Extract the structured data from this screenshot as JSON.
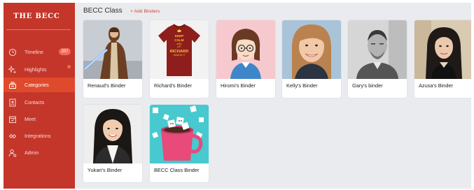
{
  "app": {
    "logo_text": "THE BECC"
  },
  "sidebar": {
    "items": [
      {
        "label": "Timeline",
        "icon": "clock-icon",
        "badge": "207"
      },
      {
        "label": "Highlights",
        "icon": "sparkle-icon"
      },
      {
        "label": "Categories",
        "icon": "stack-icon",
        "active": true
      },
      {
        "label": "Contacts",
        "icon": "contact-book-icon"
      },
      {
        "label": "Meet",
        "icon": "calendar-icon"
      },
      {
        "label": "Integrations",
        "icon": "link-icon"
      },
      {
        "label": "Admin",
        "icon": "admin-user-icon"
      }
    ]
  },
  "main": {
    "class_title": "BECC Class",
    "add_binders_label": "+ Add Binders",
    "binders": [
      {
        "label": "Renaud's Binder",
        "image": "jedi-costume-photo"
      },
      {
        "label": "Richard's Binder",
        "image": "red-tshirt-photo"
      },
      {
        "label": "Hiromi's Binder",
        "image": "cartoon-avatar"
      },
      {
        "label": "Kelly's Binder",
        "image": "portrait-photo"
      },
      {
        "label": "Gary's binder",
        "image": "portrait-photo-bw"
      },
      {
        "label": "Azusa's Binder",
        "image": "portrait-photo"
      },
      {
        "label": "Yukari's Binder",
        "image": "portrait-photo"
      },
      {
        "label": "BECC Class Binder",
        "image": "mug-illustration"
      }
    ],
    "tshirt_text": [
      "KEEP",
      "CALM",
      "AND",
      "LET",
      "RICHARD",
      "HANDLE IT"
    ]
  },
  "colors": {
    "sidebar_bg": "#c4362a",
    "sidebar_active": "#e04a2c",
    "accent": "#d0453a",
    "content_bg": "#e9ebee"
  }
}
